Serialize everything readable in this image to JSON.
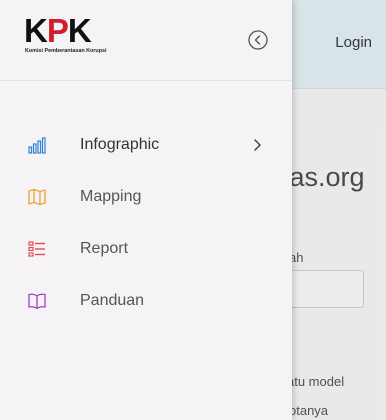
{
  "header": {
    "login_label": "Login"
  },
  "page": {
    "heading": "itas.org",
    "field_label_line1": "n",
    "field_label_line2": "ah",
    "text_line1": "atu model",
    "text_line2": "otanya"
  },
  "drawer": {
    "logo": {
      "mark": "KPK",
      "tagline": "Komisi Pemberantasan Korupsi"
    },
    "menu": [
      {
        "label": "Infographic",
        "icon": "bar-chart-icon",
        "color": "#2f7fd6",
        "has_submenu": true
      },
      {
        "label": "Mapping",
        "icon": "map-icon",
        "color": "#f0a23a",
        "has_submenu": false
      },
      {
        "label": "Report",
        "icon": "list-icon",
        "color": "#e04b57",
        "has_submenu": false
      },
      {
        "label": "Panduan",
        "icon": "book-icon",
        "color": "#a040c0",
        "has_submenu": false
      }
    ]
  }
}
